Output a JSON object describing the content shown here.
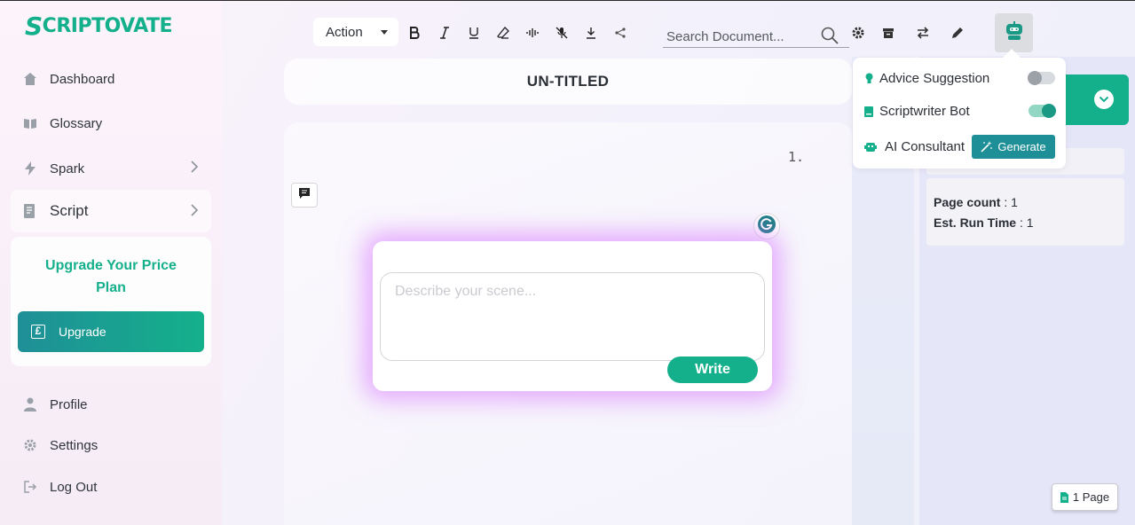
{
  "brand": {
    "logo_text": "CRIPTOVATE",
    "logo_mark": "S"
  },
  "sidebar": {
    "items": [
      {
        "label": "Dashboard",
        "icon": "home-icon"
      },
      {
        "label": "Glossary",
        "icon": "book-icon"
      },
      {
        "label": "Spark",
        "icon": "bolt-icon"
      },
      {
        "label": "Script",
        "icon": "script-icon"
      }
    ],
    "upgrade": {
      "title": "Upgrade Your Price Plan",
      "button_label": "Upgrade"
    },
    "bottom_items": [
      {
        "label": "Profile",
        "icon": "user-icon"
      },
      {
        "label": "Settings",
        "icon": "gear-icon"
      },
      {
        "label": "Log Out",
        "icon": "logout-icon"
      }
    ]
  },
  "toolbar": {
    "action_label": "Action",
    "search_placeholder": "Search Document..."
  },
  "document": {
    "title": "UN-TITLED",
    "page_number": "1."
  },
  "scene": {
    "placeholder": "Describe your scene...",
    "write_label": "Write"
  },
  "assistant_menu": {
    "advice_label": "Advice Suggestion",
    "advice_enabled": false,
    "bot_label": "Scriptwriter Bot",
    "bot_enabled": true,
    "consultant_label": "AI Consultant",
    "generate_label": "Generate"
  },
  "stats": {
    "page_count_label": "Page count",
    "page_count_value": ": 1",
    "run_time_label": "Est. Run Time",
    "run_time_value": ": 1"
  },
  "page_badge": "1 Page",
  "colors": {
    "accent": "#14b08b",
    "accent_dark": "#1f8f97",
    "glow": "#d66eff"
  }
}
